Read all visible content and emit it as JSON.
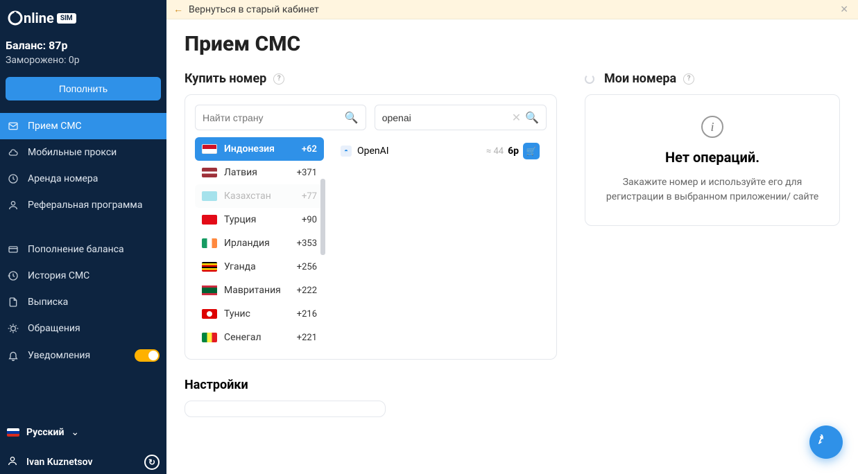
{
  "logo": {
    "text_prefix": "nline",
    "badge": "SIM"
  },
  "sidebar": {
    "balance_label": "Баланс: 87р",
    "frozen_label": "Заморожено: 0р",
    "topup_label": "Пополнить",
    "nav1": [
      {
        "label": "Прием СМС",
        "icon": "mail",
        "active": true
      },
      {
        "label": "Мобильные прокси",
        "icon": "cloud"
      },
      {
        "label": "Аренда номера",
        "icon": "clock"
      },
      {
        "label": "Реферальная программа",
        "icon": "user"
      }
    ],
    "nav2": [
      {
        "label": "Пополнение баланса",
        "icon": "card"
      },
      {
        "label": "История СМС",
        "icon": "history"
      },
      {
        "label": "Выписка",
        "icon": "doc"
      },
      {
        "label": "Обращения",
        "icon": "bug"
      },
      {
        "label": "Уведомления",
        "icon": "bell",
        "toggle": true
      }
    ],
    "language": "Русский",
    "username": "Ivan Kuznetsov"
  },
  "banner": {
    "text": "Вернуться в старый кабинет"
  },
  "page_title": "Прием СМС",
  "buy": {
    "title": "Купить номер",
    "country_placeholder": "Найти страну",
    "service_value": "openai",
    "countries": [
      {
        "name": "Индонезия",
        "code": "+62",
        "flag": "flag-id",
        "selected": true
      },
      {
        "name": "Латвия",
        "code": "+371",
        "flag": "flag-lv"
      },
      {
        "name": "Казахстан",
        "code": "+77",
        "flag": "flag-kz",
        "dim": true
      },
      {
        "name": "Турция",
        "code": "+90",
        "flag": "flag-tr"
      },
      {
        "name": "Ирландия",
        "code": "+353",
        "flag": "flag-ie"
      },
      {
        "name": "Уганда",
        "code": "+256",
        "flag": "flag-ug"
      },
      {
        "name": "Мавритания",
        "code": "+222",
        "flag": "flag-mr"
      },
      {
        "name": "Тунис",
        "code": "+216",
        "flag": "flag-tn"
      },
      {
        "name": "Сенегал",
        "code": "+221",
        "flag": "flag-sn"
      }
    ],
    "offer": {
      "name": "OpenAI",
      "approx": "≈ 44",
      "price": "6р"
    }
  },
  "mine": {
    "title": "Мои номера",
    "empty_title": "Нет операций.",
    "empty_text": "Закажите номер и используйте его для регистрации в выбранном приложении/ сайте"
  },
  "settings": {
    "title": "Настройки"
  }
}
